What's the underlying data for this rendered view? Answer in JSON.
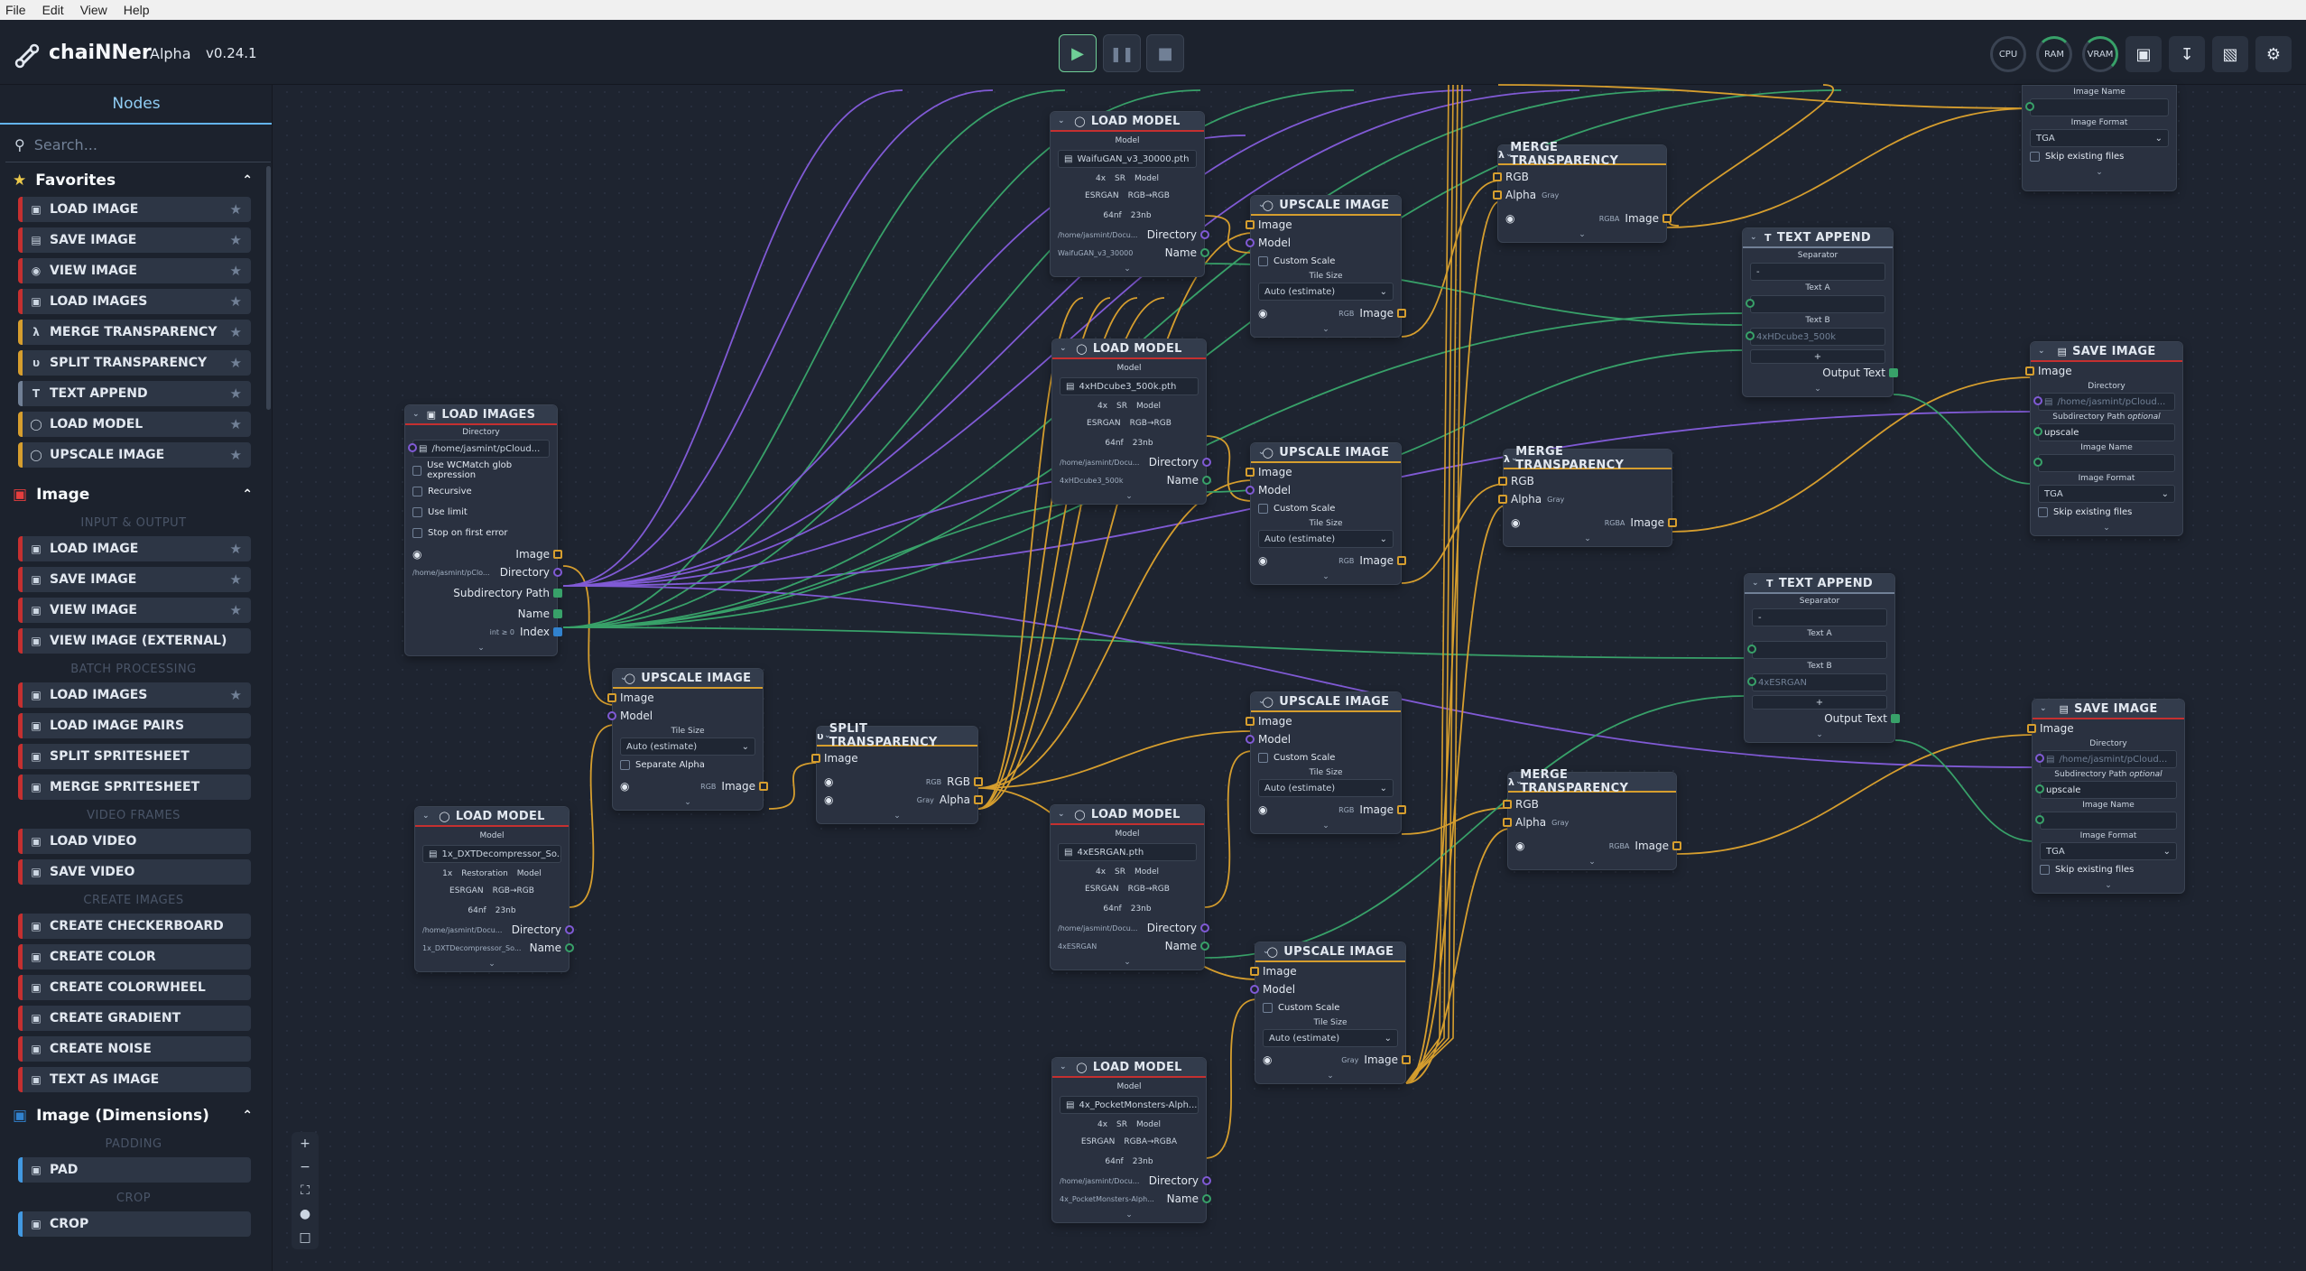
{
  "menu": [
    "File",
    "Edit",
    "View",
    "Help"
  ],
  "app": {
    "name": "chaiNNer",
    "channel": "Alpha",
    "version": "v0.24.1"
  },
  "gauges": {
    "cpu": "CPU",
    "ram": "RAM",
    "vram": "VRAM"
  },
  "sidebar": {
    "tab": "Nodes",
    "search_placeholder": "Search...",
    "favorites": {
      "title": "Favorites",
      "items": [
        "LOAD IMAGE",
        "SAVE IMAGE",
        "VIEW IMAGE",
        "LOAD IMAGES",
        "MERGE TRANSPARENCY",
        "SPLIT TRANSPARENCY",
        "TEXT APPEND",
        "LOAD MODEL",
        "UPSCALE IMAGE"
      ]
    },
    "image": {
      "title": "Image",
      "groups": [
        {
          "label": "INPUT & OUTPUT",
          "items": [
            "LOAD IMAGE",
            "SAVE IMAGE",
            "VIEW IMAGE",
            "VIEW IMAGE (EXTERNAL)"
          ]
        },
        {
          "label": "BATCH PROCESSING",
          "items": [
            "LOAD IMAGES",
            "LOAD IMAGE PAIRS",
            "SPLIT SPRITESHEET",
            "MERGE SPRITESHEET"
          ]
        },
        {
          "label": "VIDEO FRAMES",
          "items": [
            "LOAD VIDEO",
            "SAVE VIDEO"
          ]
        },
        {
          "label": "CREATE IMAGES",
          "items": [
            "CREATE CHECKERBOARD",
            "CREATE COLOR",
            "CREATE COLORWHEEL",
            "CREATE GRADIENT",
            "CREATE NOISE",
            "TEXT AS IMAGE"
          ]
        }
      ]
    },
    "dimensions": {
      "title": "Image (Dimensions)",
      "groups": [
        {
          "label": "PADDING",
          "items": [
            "PAD"
          ]
        },
        {
          "label": "CROP",
          "items": [
            "CROP"
          ]
        }
      ]
    }
  },
  "labels": {
    "load_model": "LOAD MODEL",
    "model": "Model",
    "directory": "Directory",
    "name": "Name",
    "image": "Image",
    "upscale_image": "UPSCALE IMAGE",
    "custom_scale": "Custom Scale",
    "tile_size": "Tile Size",
    "auto_estimate": "Auto (estimate)",
    "rgb": "RGB",
    "gray": "Gray",
    "rgba": "RGBA",
    "alpha": "Alpha",
    "merge_transparency": "MERGE TRANSPARENCY",
    "split_transparency": "SPLIT TRANSPARENCY",
    "load_images": "LOAD IMAGES",
    "text_append": "TEXT APPEND",
    "separator": "Separator",
    "text_a": "Text A",
    "text_b": "Text B",
    "output_text": "Output Text",
    "save_image": "SAVE IMAGE",
    "subdirectory_path": "Subdirectory Path",
    "optional": "optional",
    "image_name": "Image Name",
    "image_format": "Image Format",
    "skip_existing": "Skip existing files",
    "separate_alpha": "Separate Alpha",
    "use_wcmatch": "Use WCMatch glob expression",
    "recursive": "Recursive",
    "use_limit": "Use limit",
    "stop_on_error": "Stop on first error",
    "index": "Index",
    "int_0": "int ≥ 0",
    "esrgan": "ESRGAN",
    "nf": "64nf",
    "nb": "23nb",
    "sr": "SR",
    "tga": "TGA",
    "upscale": "upscale",
    "dash": "-",
    "restoration": "Restoration"
  },
  "models": [
    {
      "file": "WaifuGAN_v3_30000.pth",
      "scale": "4x",
      "type": "SR",
      "ch": "RGB→RGB",
      "dir": "/home/jasmint/Docu...",
      "name": "WaifuGAN_v3_30000"
    },
    {
      "file": "4xHDcube3_500k.pth",
      "scale": "4x",
      "type": "SR",
      "ch": "RGB→RGB",
      "dir": "/home/jasmint/Docu...",
      "name": "4xHDcube3_500k"
    },
    {
      "file": "4xESRGAN.pth",
      "scale": "4x",
      "type": "SR",
      "ch": "RGB→RGB",
      "dir": "/home/jasmint/Docu...",
      "name": "4xESRGAN"
    },
    {
      "file": "4x_PocketMonsters-Alph...",
      "scale": "4x",
      "type": "SR",
      "ch": "RGBA→RGBA",
      "dir": "/home/jasmint/Docu...",
      "name": "4x_PocketMonsters-Alph..."
    },
    {
      "file": "1x_DXTDecompressor_So...",
      "scale": "1x",
      "type": "Restoration",
      "ch": "RGB→RGB",
      "dir": "/home/jasmint/Docu...",
      "name": "1x_DXTDecompressor_So..."
    }
  ],
  "load_images": {
    "dir": "/home/jasmint/pCloud...",
    "dir_out": "/home/jasmint/pClo...",
    "subdir": "Subdirectory Path"
  },
  "text_append": [
    {
      "text_b": "4xHDcube3_500k"
    },
    {
      "text_b": "4xESRGAN"
    }
  ],
  "save_image": [
    {
      "dir": "/home/jasmint/pCloud..."
    },
    {
      "dir": "/home/jasmint/pCloud..."
    }
  ]
}
